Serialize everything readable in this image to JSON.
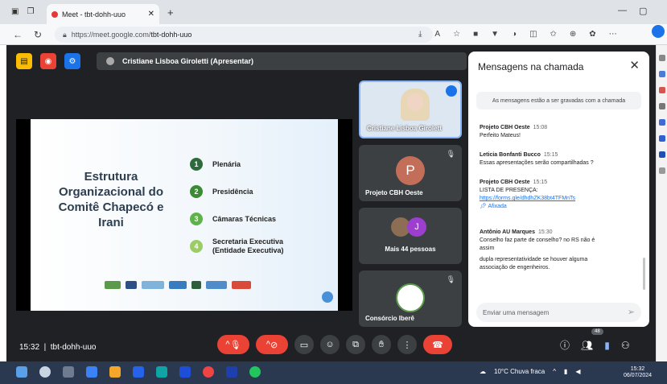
{
  "browser": {
    "tab_title": "Meet - tbt-dohh-uuo",
    "new_tab": "+",
    "url_host": "https://meet.google.com/",
    "url_path": "tbt-dohh-uuo"
  },
  "meet": {
    "presenter_label": "Cristiane Lisboa Giroletti (Apresentar)",
    "slide": {
      "title": "Estrutura Organizacional do Comitê Chapecó e Irani",
      "items": [
        {
          "num": "1",
          "text": "Plenária",
          "color": "#2e6b3c"
        },
        {
          "num": "2",
          "text": "Presidência",
          "color": "#3c8a34"
        },
        {
          "num": "3",
          "text": "Câmaras Técnicas",
          "color": "#5fb24a"
        },
        {
          "num": "4",
          "text": "Secretaria Executiva (Entidade Executiva)",
          "color": "#9ccc65"
        }
      ]
    },
    "tiles": [
      {
        "label": "Cristiane Lisboa Girolett"
      },
      {
        "label": "Projeto CBH Oeste",
        "initial": "P"
      },
      {
        "label": "Mais 44 pessoas",
        "initial": "J"
      },
      {
        "label": "Consórcio Iberê"
      }
    ],
    "time": "15:32",
    "meeting_code": "tbt-dohh-uuo",
    "participants_badge": "48"
  },
  "chat": {
    "title": "Mensagens na chamada",
    "note": "As mensagens estão a ser gravadas com a chamada",
    "messages": [
      {
        "who": "Projeto CBH Oeste",
        "time": "15:08",
        "lines": [
          "Perfeito Mateus!"
        ]
      },
      {
        "who": "Leticia Bonfanti Bucco",
        "time": "15:15",
        "lines": [
          "Essas apresentações serão compartilhadas ?"
        ]
      },
      {
        "who": "Projeto CBH Oeste",
        "time": "15:15",
        "lines": [
          "LISTA DE PRESENÇA:"
        ],
        "link": "https://forms.gle/dhdhZK38bt4TFMnTs",
        "pinned": "Afixada"
      },
      {
        "who": "Antônio AU Marques",
        "time": "15:30",
        "lines": [
          "Conselho faz parte de conselho? no RS não é assim",
          "dupla representatividade se houver alguma associação de engenheiros."
        ]
      }
    ],
    "input_placeholder": "Enviar uma mensagem"
  },
  "taskbar": {
    "weather": "10°C  Chuva fraca",
    "clock": "15:32",
    "date": "06/07/2024"
  }
}
